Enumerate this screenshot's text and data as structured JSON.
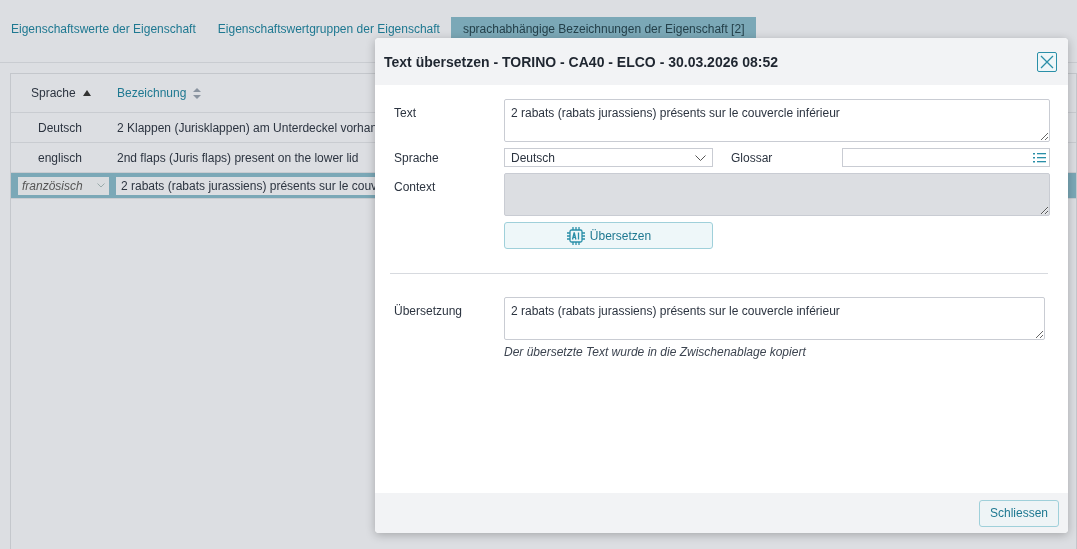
{
  "tabs": [
    {
      "label": "Eigenschaftswerte der Eigenschaft",
      "selected": false
    },
    {
      "label": "Eigenschaftswertgruppen der Eigenschaft",
      "selected": false
    },
    {
      "label": "sprachabhängige Bezeichnungen der Eigenschaft [2]",
      "selected": true
    }
  ],
  "table": {
    "columns": [
      {
        "label": "Sprache",
        "sorted": true
      },
      {
        "label": "Bezeichnung",
        "sorted": false
      }
    ],
    "rows": [
      {
        "sprache": "Deutsch",
        "bezeichnung": "2 Klappen (Jurisklappen) am Unterdeckel vorhan",
        "selected": false
      },
      {
        "sprache": "englisch",
        "bezeichnung": "2nd flaps (Juris flaps) present on the lower lid",
        "selected": false
      },
      {
        "sprache": "französisch",
        "bezeichnung": "2 rabats (rabats jurassiens) présents sur le couv",
        "selected": true
      }
    ]
  },
  "dialog": {
    "title": "Text übersetzen - TORINO - CA40 - ELCO - 30.03.2026 08:52",
    "text": {
      "label": "Text",
      "value": "2 rabats (rabats jurassiens) présents sur le couvercle inférieur"
    },
    "sprache": {
      "label": "Sprache",
      "value": "Deutsch"
    },
    "glossar": {
      "label": "Glossar"
    },
    "context": {
      "label": "Context",
      "disabled": true
    },
    "translate_button": "Übersetzen",
    "translation": {
      "label": "Übersetzung",
      "value": "2 rabats (rabats jurassiens) présents sur le couvercle inférieur"
    },
    "note": "Der übersetzte Text wurde in die Zwischenablage kopiert",
    "close_button": "Schliessen"
  }
}
